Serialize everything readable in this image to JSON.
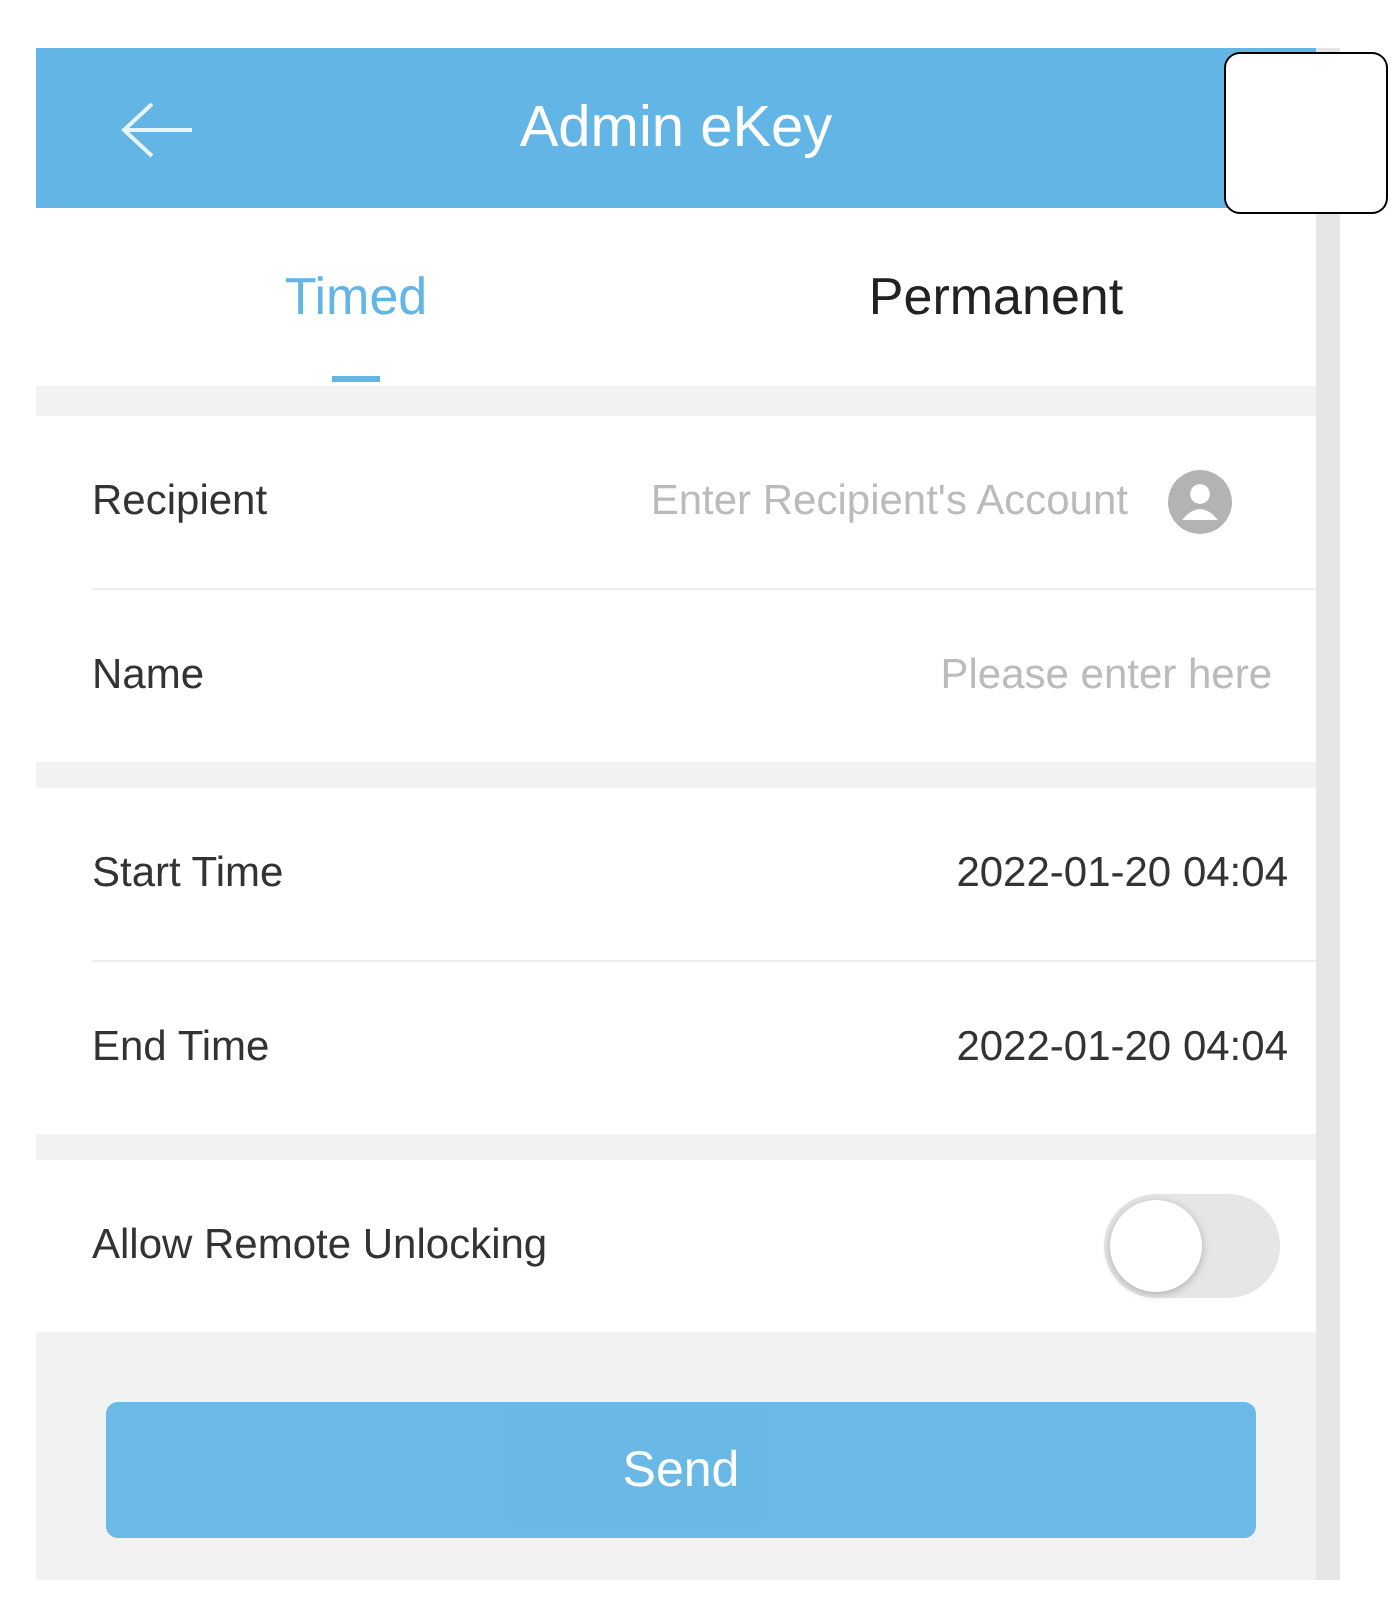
{
  "header": {
    "title": "Admin eKey"
  },
  "tabs": [
    {
      "label": "Timed",
      "selected": true
    },
    {
      "label": "Permanent",
      "selected": false
    }
  ],
  "recipient": {
    "label": "Recipient",
    "placeholder": "Enter Recipient's Account"
  },
  "name": {
    "label": "Name",
    "placeholder": "Please enter here"
  },
  "times": [
    {
      "label": "Start Time",
      "value": "2022-01-20 04:04"
    },
    {
      "label": "End Time",
      "value": "2022-01-20 04:04"
    }
  ],
  "remote_unlocking": {
    "label": "Allow Remote Unlocking",
    "on": false
  },
  "send_button": {
    "label": "Send"
  }
}
